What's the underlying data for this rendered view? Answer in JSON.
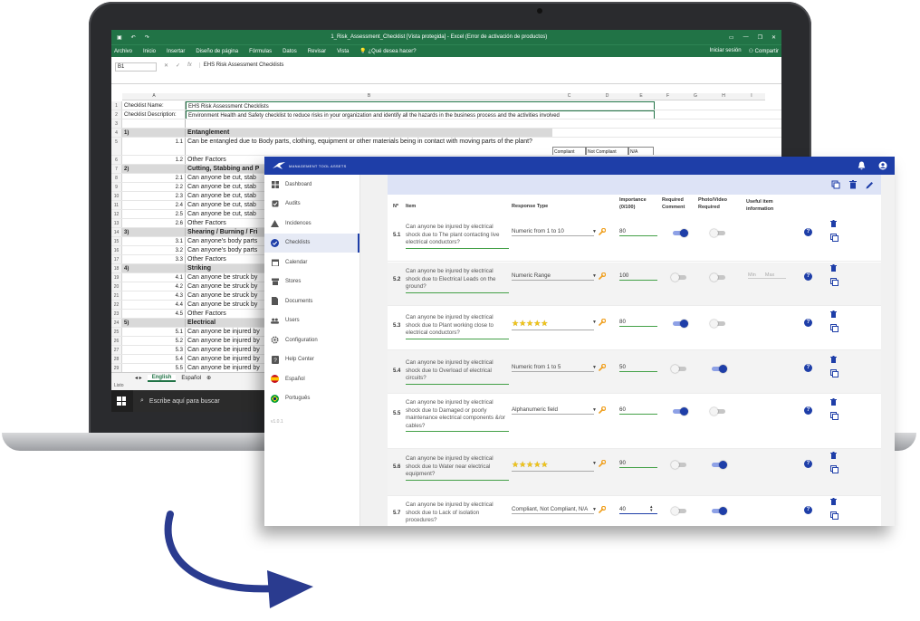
{
  "excel": {
    "title": "1_Risk_Assessment_Checklist  [Vista protegida]  -  Excel (Error de activación de productos)",
    "ribbon": [
      "Archivo",
      "Inicio",
      "Insertar",
      "Diseño de página",
      "Fórmulas",
      "Datos",
      "Revisar",
      "Vista"
    ],
    "tell_me": "¿Qué desea hacer?",
    "sign_in": "Iniciar sesión",
    "share": "Compartir",
    "name_box": "B1",
    "formula_value": "EHS Risk Assessment Checklists",
    "columns": [
      "A",
      "B",
      "C",
      "D",
      "E",
      "F",
      "G",
      "H",
      "I"
    ],
    "rows": [
      {
        "n": "1",
        "a": "Checklist Name:",
        "b": "EHS Risk Assessment Checklists"
      },
      {
        "n": "2",
        "a": "Checklist Description:",
        "b": "Environment Health and Safety checklist to reduce risks in your organization and identify all the hazards in the business process and the activities  involved"
      },
      {
        "n": "3",
        "a": "",
        "b": ""
      },
      {
        "n": "4",
        "a": "1)",
        "b": "Entanglement"
      },
      {
        "n": "5",
        "a": "1.1",
        "b": "Can be entangled due to Body parts, clothing, equipment or other materials being in contact with moving parts of the plant?"
      },
      {
        "n": "6",
        "a": "1.2",
        "b": "Other Factors"
      },
      {
        "n": "7",
        "a": "2)",
        "b": "Cutting, Stabbing and P"
      },
      {
        "n": "8",
        "a": "2.1",
        "b": "Can anyone be cut, stab"
      },
      {
        "n": "9",
        "a": "2.2",
        "b": "Can anyone be cut, stab"
      },
      {
        "n": "10",
        "a": "2.3",
        "b": "Can anyone be cut, stab"
      },
      {
        "n": "11",
        "a": "2.4",
        "b": "Can anyone be cut, stab"
      },
      {
        "n": "12",
        "a": "2.5",
        "b": "Can anyone be cut, stab"
      },
      {
        "n": "13",
        "a": "2.6",
        "b": "Other Factors"
      },
      {
        "n": "14",
        "a": "3)",
        "b": "Shearing / Burning / Fri"
      },
      {
        "n": "15",
        "a": "3.1",
        "b": "Can anyone's body parts"
      },
      {
        "n": "16",
        "a": "3.2",
        "b": "Can anyone's body parts"
      },
      {
        "n": "17",
        "a": "3.3",
        "b": "Other Factors"
      },
      {
        "n": "18",
        "a": "4)",
        "b": "Striking"
      },
      {
        "n": "19",
        "a": "4.1",
        "b": "Can anyone be struck by"
      },
      {
        "n": "20",
        "a": "4.2",
        "b": "Can anyone be struck by"
      },
      {
        "n": "21",
        "a": "4.3",
        "b": "Can anyone be struck by"
      },
      {
        "n": "22",
        "a": "4.4",
        "b": "Can anyone be struck by"
      },
      {
        "n": "23",
        "a": "4.5",
        "b": "Other Factors"
      },
      {
        "n": "24",
        "a": "5)",
        "b": "Electrical"
      },
      {
        "n": "25",
        "a": "5.1",
        "b": "Can anyone be injured by"
      },
      {
        "n": "26",
        "a": "5.2",
        "b": "Can anyone be injured by"
      },
      {
        "n": "27",
        "a": "5.3",
        "b": "Can anyone be injured by"
      },
      {
        "n": "28",
        "a": "5.4",
        "b": "Can anyone be injured by"
      },
      {
        "n": "29",
        "a": "5.5",
        "b": "Can anyone be injured by"
      }
    ],
    "row5_headers": {
      "c": "Compliant",
      "d": "Not Compliant",
      "e": "N/A"
    },
    "sheet_tabs": [
      "English",
      "Español"
    ],
    "status": "Listo",
    "taskbar_search": "Escribe aquí para buscar"
  },
  "app": {
    "brand": "MANAGEMENT TOOL ASSETS",
    "nav": [
      {
        "label": "Dashboard",
        "icon": "dashboard-icon"
      },
      {
        "label": "Audits",
        "icon": "audits-icon"
      },
      {
        "label": "Incidences",
        "icon": "warning-icon"
      },
      {
        "label": "Checklists",
        "icon": "check-circle-icon"
      },
      {
        "label": "Calendar",
        "icon": "calendar-icon"
      },
      {
        "label": "Stores",
        "icon": "store-icon"
      },
      {
        "label": "Documents",
        "icon": "document-icon"
      },
      {
        "label": "Users",
        "icon": "users-icon"
      },
      {
        "label": "Configuration",
        "icon": "gear-icon"
      },
      {
        "label": "Help Center",
        "icon": "help-icon"
      },
      {
        "label": "Español",
        "icon": "flag-spain-icon"
      },
      {
        "label": "Português",
        "icon": "flag-brazil-icon"
      }
    ],
    "version": "v1.0.1",
    "headers": {
      "num": "Nº",
      "item": "Item",
      "response": "Response Type",
      "importance": "Importance (0/100)",
      "required_comment": "Required Comment",
      "photo_video": "Photo/Video Required",
      "useful": "Useful item information"
    },
    "rows": [
      {
        "num": "5.1",
        "item": "Can anyone be injured by electrical shock due to The plant contacting live electrical conductors?",
        "response": "Numeric from 1 to 10",
        "importance": "80",
        "comment_on": true,
        "photo_on": false
      },
      {
        "num": "5.2",
        "item": "Can anyone be injured by electrical shock due to Electrical Leads on the ground?",
        "response": "Numeric Range",
        "importance": "100",
        "comment_on": false,
        "photo_on": false,
        "min": "Min",
        "max": "Max"
      },
      {
        "num": "5.3",
        "item": "Can anyone be injured by electrical shock due to Plant working close to electrical conductors?",
        "response": "★★★★★",
        "importance": "80",
        "comment_on": true,
        "photo_on": false
      },
      {
        "num": "5.4",
        "item": "Can anyone be injured by electrical shock due to Overload of electrical circuits?",
        "response": "Numeric from 1 to 5",
        "importance": "50",
        "comment_on": false,
        "photo_on": true
      },
      {
        "num": "5.5",
        "item": "Can anyone be injured by electrical shock due to Damaged or poorly maintenance electrical components &/or cables?",
        "response": "Alphanumeric field",
        "importance": "60",
        "comment_on": true,
        "photo_on": false
      },
      {
        "num": "5.6",
        "item": "Can anyone be injured by electrical shock due to Water near electrical equipment?",
        "response": "★★★★★",
        "importance": "90",
        "comment_on": false,
        "photo_on": true
      },
      {
        "num": "5.7",
        "item": "Can anyone be injured by electrical shock due to Lack of isolation procedures?",
        "response": "Compliant, Not Compliant, N/A",
        "importance": "40",
        "comment_on": false,
        "photo_on": true
      }
    ]
  },
  "colors": {
    "excel_green": "#217346",
    "app_blue": "#1e3ea8",
    "header_band": "#dde3f6",
    "toggle_on": "#1e3ea8",
    "star": "#f0c419",
    "wrench": "#f0a020",
    "arrow": "#2a3b8f"
  }
}
